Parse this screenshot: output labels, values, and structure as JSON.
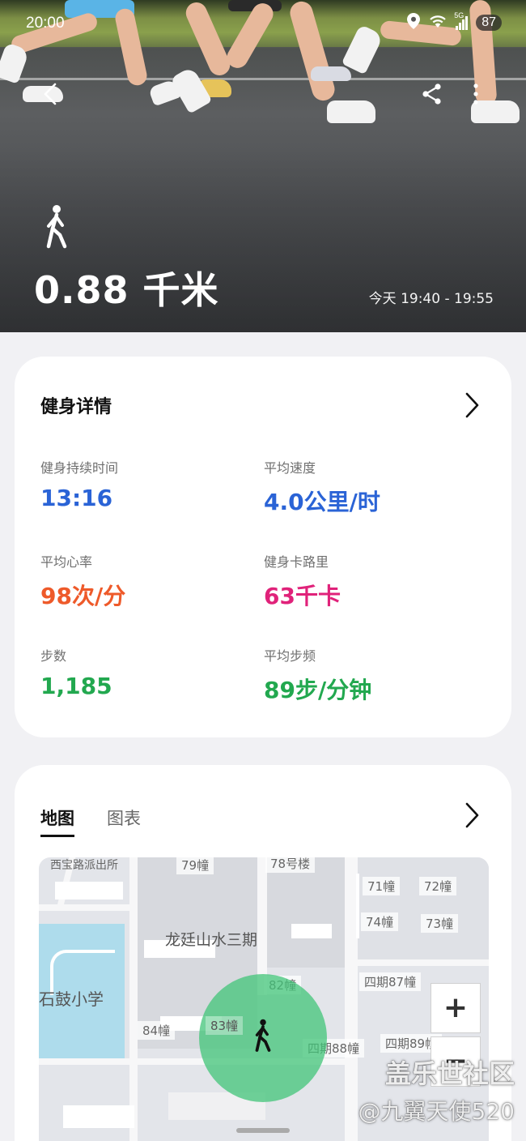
{
  "status_bar": {
    "time": "20:00",
    "network": "5G",
    "battery": "87"
  },
  "hero": {
    "distance": "0.88 千米",
    "time_range": "今天 19:40 - 19:55"
  },
  "details": {
    "title": "健身详情",
    "metrics": [
      {
        "label": "健身持续时间",
        "value": "13:16",
        "color": "#2a63d6"
      },
      {
        "label": "平均速度",
        "value": "4.0公里/时",
        "color": "#2a63d6"
      },
      {
        "label": "平均心率",
        "value": "98次/分",
        "color": "#ee5a2a"
      },
      {
        "label": "健身卡路里",
        "value": "63千卡",
        "color": "#e0227a"
      },
      {
        "label": "步数",
        "value": "1,185",
        "color": "#22a84f"
      },
      {
        "label": "平均步频",
        "value": "89步/分钟",
        "color": "#22a84f"
      }
    ]
  },
  "map_card": {
    "tabs": [
      "地图",
      "图表"
    ],
    "active_tab": "地图",
    "labels": {
      "police": "西宝路派出所",
      "b79": "79幢",
      "b78": "78号楼",
      "b71": "71幢",
      "b72": "72幢",
      "b74": "74幢",
      "b73": "73幢",
      "area": "龙廷山水三期",
      "school": "石鼓小学",
      "b82": "82幢",
      "b87": "四期87幢",
      "b84": "84幢",
      "b83": "83幢",
      "b88": "四期88幢",
      "b89": "四期89幢"
    },
    "zoom_in": "+",
    "zoom_out": "−"
  },
  "watermark": {
    "line1": "盖乐世社区",
    "line2": "@九翼天使520"
  }
}
